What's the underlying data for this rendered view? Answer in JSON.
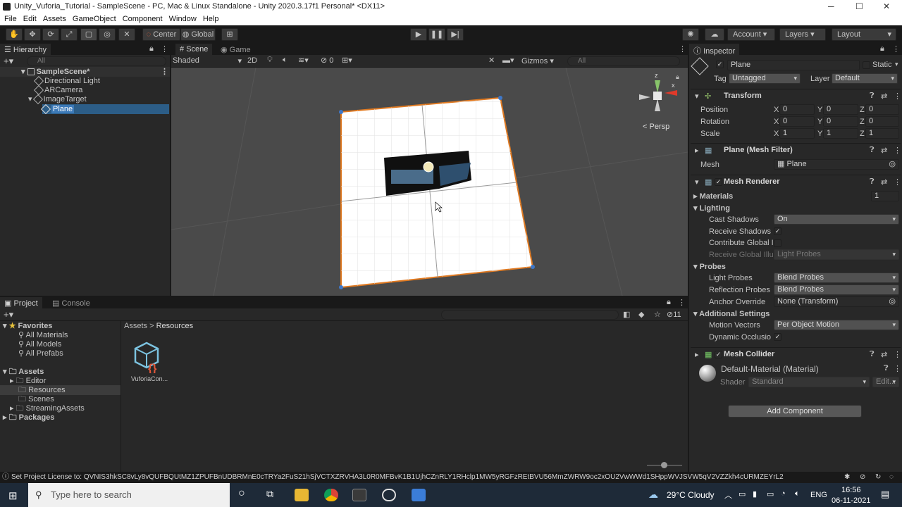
{
  "window": {
    "title": "Unity_Vuforia_Tutorial - SampleScene - PC, Mac & Linux Standalone - Unity 2020.3.17f1 Personal* <DX11>"
  },
  "menu": [
    "File",
    "Edit",
    "Assets",
    "GameObject",
    "Component",
    "Window",
    "Help"
  ],
  "toolbar": {
    "center": "Center",
    "global": "Global",
    "account": "Account",
    "layers": "Layers",
    "layout": "Layout"
  },
  "hierarchy": {
    "tab": "Hierarchy",
    "search_placeholder": "All",
    "items": [
      {
        "label": "SampleScene*"
      },
      {
        "label": "Directional Light"
      },
      {
        "label": "ARCamera"
      },
      {
        "label": "ImageTarget"
      },
      {
        "label": "Plane"
      }
    ]
  },
  "scene": {
    "tab_scene": "Scene",
    "tab_game": "Game",
    "shading": "Shaded",
    "mode_2d": "2D",
    "hidden_count": "0",
    "gizmos": "Gizmos",
    "search_placeholder": "All",
    "persp": "< Persp"
  },
  "inspector": {
    "tab": "Inspector",
    "name": "Plane",
    "static": "Static",
    "tag_label": "Tag",
    "tag": "Untagged",
    "layer_label": "Layer",
    "layer": "Default",
    "transform": {
      "title": "Transform",
      "position": {
        "label": "Position",
        "x": "0",
        "y": "0",
        "z": "0"
      },
      "rotation": {
        "label": "Rotation",
        "x": "0",
        "y": "0",
        "z": "0"
      },
      "scale": {
        "label": "Scale",
        "x": "1",
        "y": "1",
        "z": "1"
      }
    },
    "mesh_filter": {
      "title": "Plane (Mesh Filter)",
      "mesh_label": "Mesh",
      "mesh": "Plane"
    },
    "mesh_renderer": {
      "title": "Mesh Renderer",
      "materials": "Materials",
      "materials_count": "1",
      "lighting": "Lighting",
      "cast_shadows": "Cast Shadows",
      "cast_shadows_val": "On",
      "receive_shadows": "Receive Shadows",
      "contribute_gi": "Contribute Global I",
      "receive_gi": "Receive Global Illu",
      "receive_gi_val": "Light Probes",
      "probes": "Probes",
      "light_probes": "Light Probes",
      "light_probes_val": "Blend Probes",
      "reflection_probes": "Reflection Probes",
      "reflection_probes_val": "Blend Probes",
      "anchor_override": "Anchor Override",
      "anchor_override_val": "None (Transform)",
      "additional": "Additional Settings",
      "motion_vectors": "Motion Vectors",
      "motion_vectors_val": "Per Object Motion",
      "dynamic_occlusion": "Dynamic Occlusio"
    },
    "mesh_collider": {
      "title": "Mesh Collider"
    },
    "material": {
      "name": "Default-Material (Material)",
      "shader_label": "Shader",
      "shader": "Standard",
      "edit": "Edit..."
    },
    "add_component": "Add Component"
  },
  "project": {
    "tab_project": "Project",
    "tab_console": "Console",
    "count": "11",
    "favorites": "Favorites",
    "fav_items": [
      "All Materials",
      "All Models",
      "All Prefabs"
    ],
    "assets": "Assets",
    "asset_items": [
      "Editor",
      "Resources",
      "Scenes",
      "StreamingAssets"
    ],
    "packages": "Packages",
    "breadcrumb_root": "Assets",
    "breadcrumb_sep": ">",
    "breadcrumb_current": "Resources",
    "file_name": "VuforiaCon..."
  },
  "status": {
    "message": "Set Project License to: QVNIS3hkSC8vLy8vQUFBQUtMZ1ZPUFBnUDBRMnE0cTRYa2FuS21hSjVCTXZRVHA3L0R0MFBvK1B1UjhCZnRLY1RHclp1MW5yRGFzREtBVU56MmZWRW9oc2xOU2VwWWd1SHppWVJSVW5qV2VZZkh4cURMZEYrL2"
  },
  "taskbar": {
    "search_placeholder": "Type here to search",
    "weather": "29°C  Cloudy",
    "lang": "ENG",
    "time": "16:56",
    "date": "06-11-2021"
  }
}
